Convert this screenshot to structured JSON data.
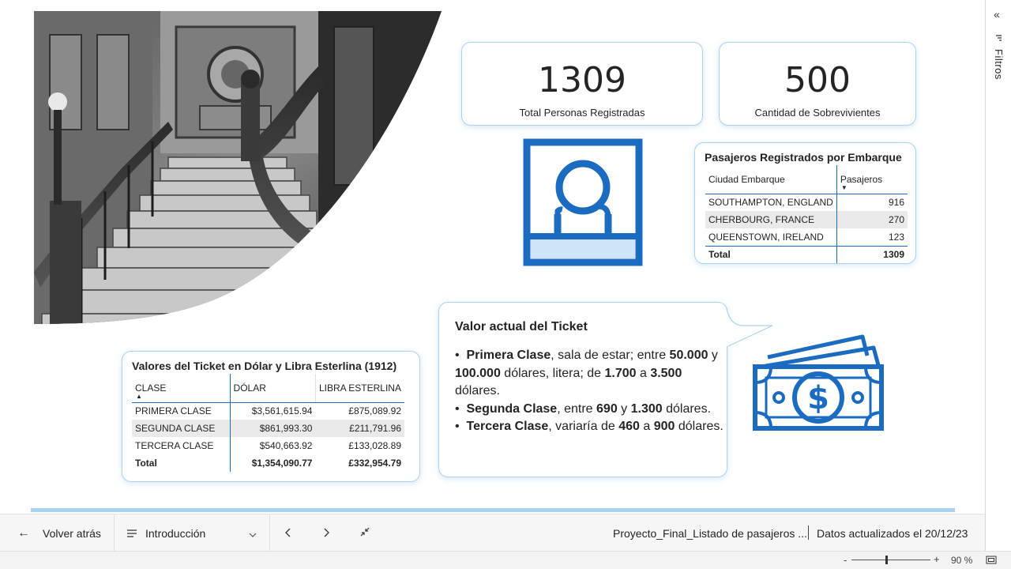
{
  "kpis": [
    {
      "value": "1309",
      "label": "Total Personas Registradas"
    },
    {
      "value": "500",
      "label": "Cantidad de  Sobrevivientes"
    }
  ],
  "embarque_table": {
    "title": "Pasajeros Registrados por Embarque",
    "headers": [
      "Ciudad Embarque",
      "Pasajeros"
    ],
    "rows": [
      [
        "SOUTHAMPTON, ENGLAND",
        "916"
      ],
      [
        "CHERBOURG, FRANCE",
        "270"
      ],
      [
        "QUEENSTOWN, IRELAND",
        "123"
      ]
    ],
    "total": [
      "Total",
      "1309"
    ]
  },
  "ticket_table": {
    "title": "Valores del Ticket en Dólar y Libra Esterlina (1912)",
    "headers": [
      "CLASE",
      "DÓLAR",
      "LIBRA ESTERLINA"
    ],
    "rows": [
      [
        "PRIMERA CLASE",
        "$3,561,615.94",
        "£875,089.92"
      ],
      [
        "SEGUNDA CLASE",
        "$861,993.30",
        "£211,791.96"
      ],
      [
        "TERCERA CLASE",
        "$540,663.92",
        "£133,028.89"
      ]
    ],
    "total": [
      "Total",
      "$1,354,090.77",
      "£332,954.79"
    ]
  },
  "ticket_info": {
    "title": "Valor actual del Ticket",
    "bullet": "•",
    "l1_a": "Primera Clase",
    "l1_b": ", sala de estar; entre ",
    "l1_c": "50.000",
    "l1_d": " y ",
    "l1_e": "100.000",
    "l1_f": " dólares, litera; de ",
    "l1_g": "1.700",
    "l1_h": " a ",
    "l1_i": "3.500",
    "l1_j": " dólares.",
    "l2_a": "Segunda Clase",
    "l2_b": ", entre ",
    "l2_c": "690",
    "l2_d": " y ",
    "l2_e": "1.300",
    "l2_f": " dólares.",
    "l3_a": "Tercera Clase",
    "l3_b": ", variaría de ",
    "l3_c": "460",
    "l3_d": " a ",
    "l3_e": "900",
    "l3_f": " dólares."
  },
  "filters_pane": {
    "label": "Filtros"
  },
  "bottom_nav": {
    "back_label": "Volver atrás",
    "page_label": "Introducción",
    "report_name": "Proyecto_Final_Listado de pasajeros ...",
    "updated": "Datos actualizados el 20/12/23"
  },
  "status_bar": {
    "zoom_minus": "-",
    "zoom_plus": "+",
    "zoom_level": "90 %"
  },
  "colors": {
    "accent": "#1b6cc1",
    "light_accent": "#a9d3f3",
    "icon_fill": "#cfe4f9"
  },
  "icons": [
    "person-badge-icon",
    "money-icon",
    "back-arrow-icon",
    "pages-menu-icon",
    "chevron-down-icon",
    "chevron-left-icon",
    "chevron-right-icon",
    "collapse-icon",
    "fit-page-icon",
    "expand-pane-icon",
    "filter-icon"
  ]
}
